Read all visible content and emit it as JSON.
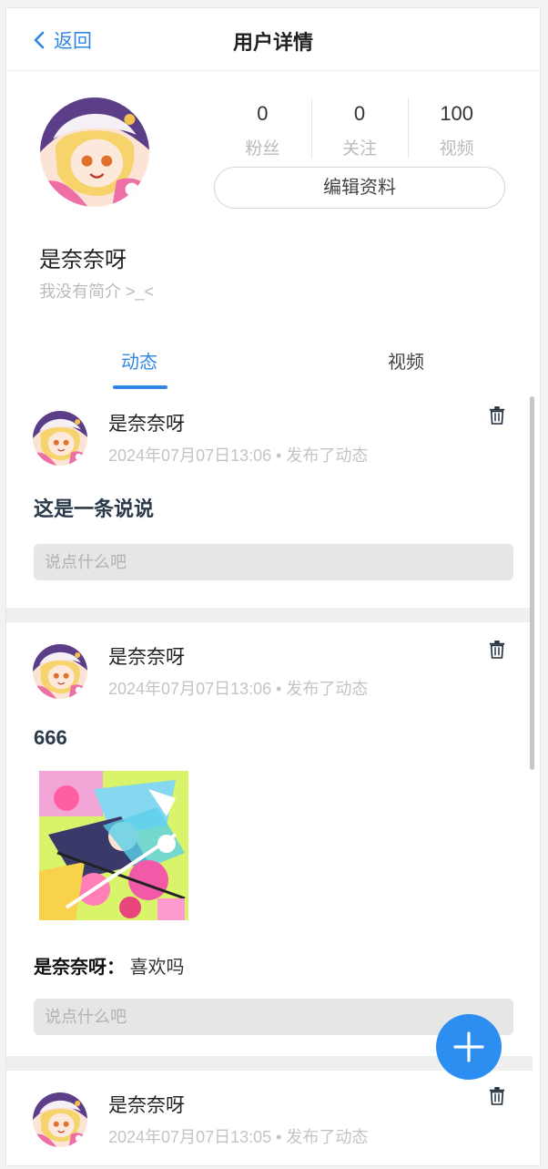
{
  "nav": {
    "back_label": "返回",
    "title": "用户详情"
  },
  "profile": {
    "stats": [
      {
        "value": "0",
        "label": "粉丝"
      },
      {
        "value": "0",
        "label": "关注"
      },
      {
        "value": "100",
        "label": "视频"
      }
    ],
    "edit_label": "编辑资料",
    "username": "是奈奈呀",
    "bio": "我没有简介 >_<"
  },
  "tabs": {
    "active": "动态",
    "inactive": "视频"
  },
  "posts": [
    {
      "author": "是奈奈呀",
      "time": "2024年07月07日13:06 • 发布了动态",
      "content": "这是一条说说",
      "comment_placeholder": "说点什么吧"
    },
    {
      "author": "是奈奈呀",
      "time": "2024年07月07日13:06 • 发布了动态",
      "content": "666",
      "comment_author": "是奈奈呀：",
      "comment_text": "喜欢吗",
      "comment_placeholder": "说点什么吧"
    },
    {
      "author": "是奈奈呀",
      "time": "2024年07月07日13:05 • 发布了动态"
    }
  ],
  "colors": {
    "accent": "#2f86e6",
    "fab": "#2b8ef0",
    "muted": "#c4c4c4"
  },
  "icons": {
    "back": "chevron-left-icon",
    "delete": "trash-icon",
    "add": "plus-icon"
  }
}
